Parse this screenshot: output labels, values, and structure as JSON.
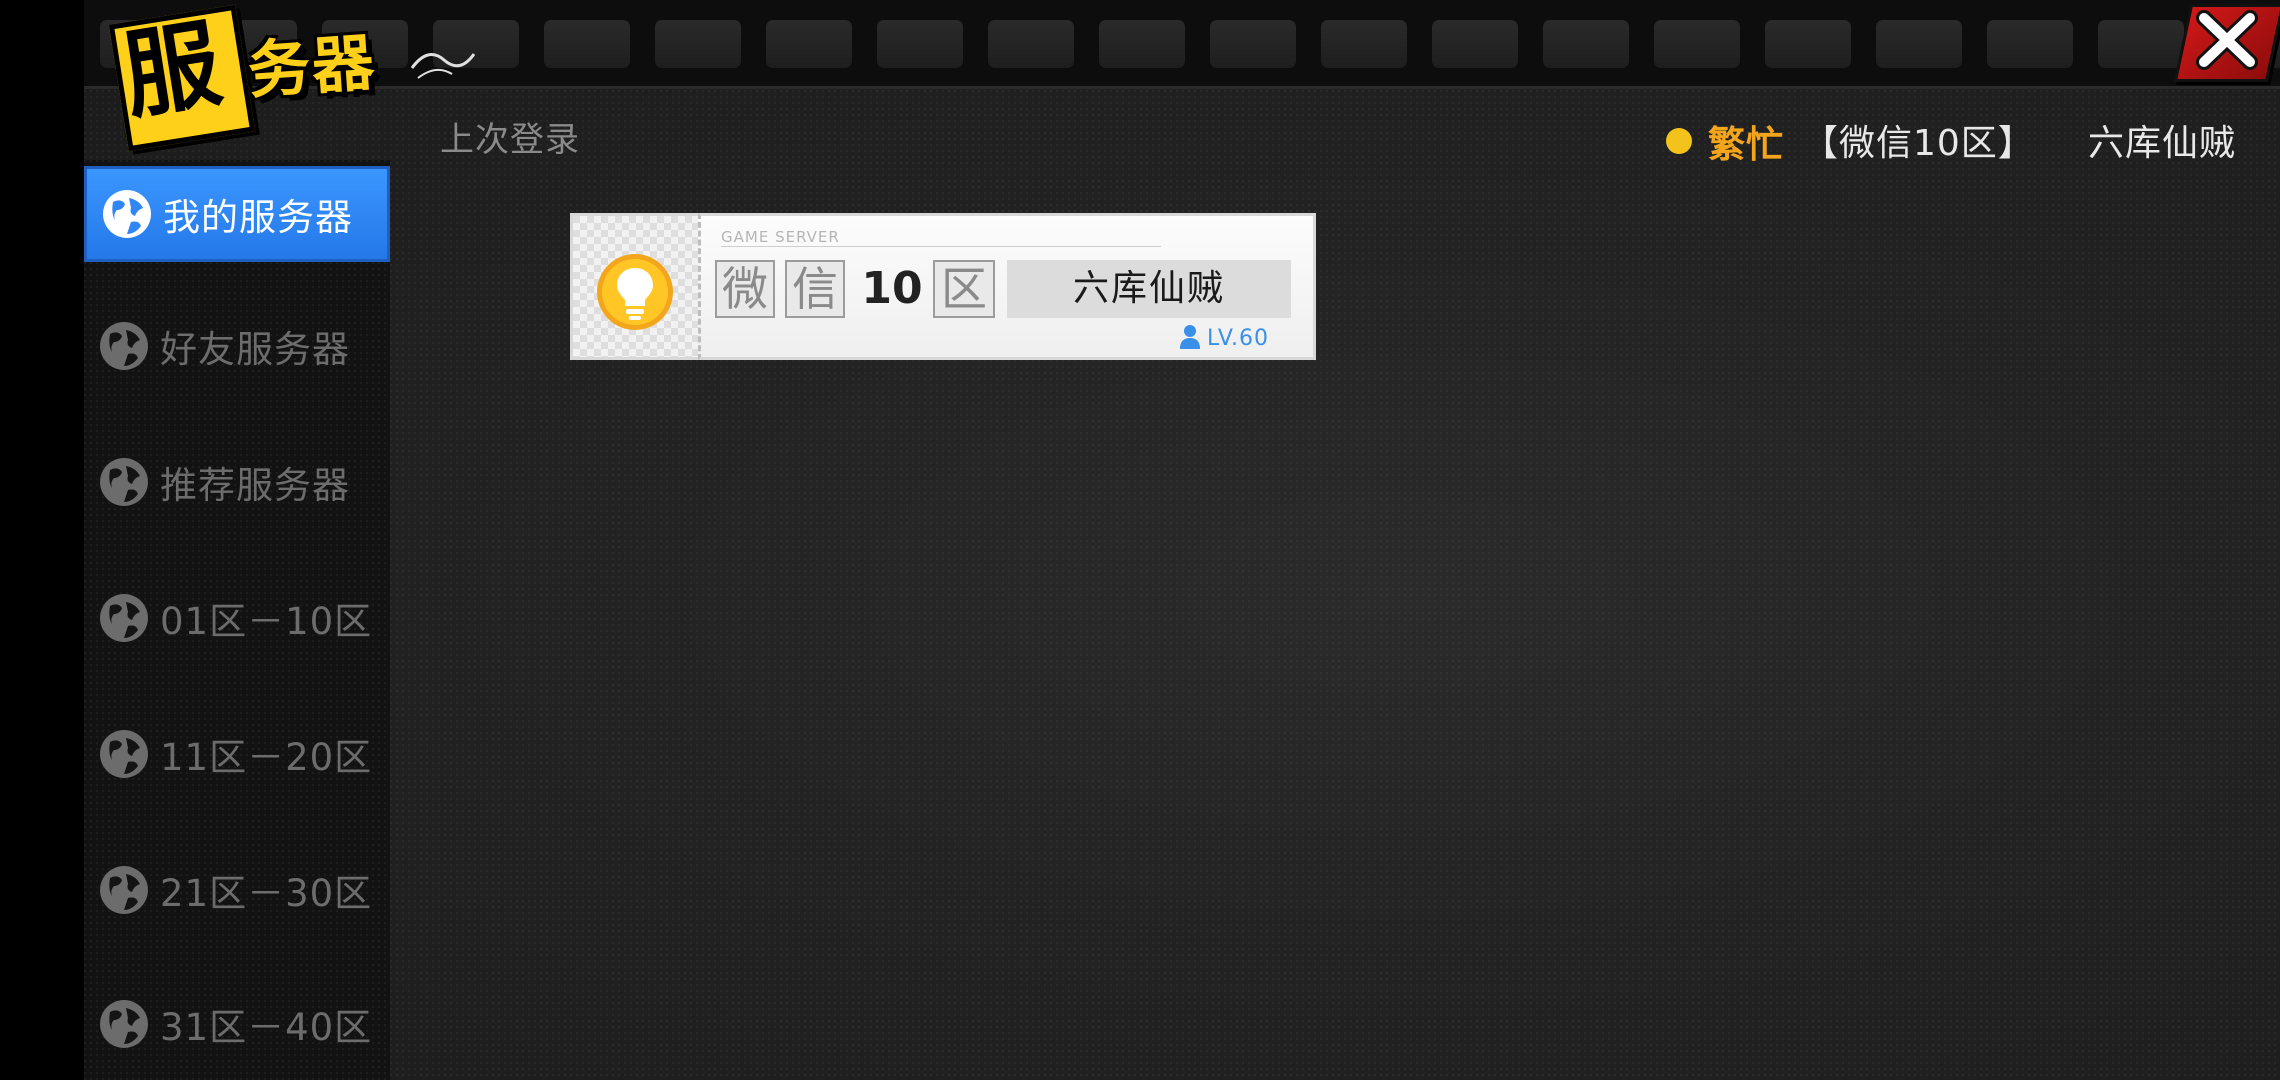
{
  "header": {
    "title_char_1": "服",
    "title_rest": "务器"
  },
  "sidebar": {
    "items": [
      {
        "label": "我的服务器",
        "active": true
      },
      {
        "label": "好友服务器",
        "active": false
      },
      {
        "label": "推荐服务器",
        "active": false
      },
      {
        "label": "01区－10区",
        "active": false
      },
      {
        "label": "11区－20区",
        "active": false
      },
      {
        "label": "21区－30区",
        "active": false
      },
      {
        "label": "31区－40区",
        "active": false
      }
    ]
  },
  "last_login": {
    "label": "上次登录",
    "status": "繁忙",
    "server": "【微信10区】",
    "player": "六库仙贼"
  },
  "server_card": {
    "tag": "GAME SERVER",
    "zone_char_1": "微",
    "zone_char_2": "信",
    "zone_number": "10",
    "zone_char_3": "区",
    "player": "六库仙贼",
    "level": "LV.60"
  },
  "icons": {
    "close": "close-icon",
    "globe": "globe-icon",
    "bulb": "lightbulb-icon",
    "person": "person-icon"
  },
  "colors": {
    "accent_blue": "#2f86f6",
    "status_busy": "#f3a61b",
    "title_yellow": "#ffd01a",
    "close_red": "#c81414",
    "level_blue": "#3a8fe8"
  }
}
